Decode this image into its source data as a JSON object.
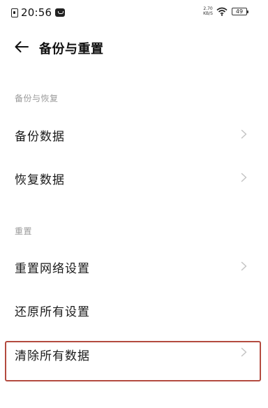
{
  "status_bar": {
    "time": "20:56",
    "net_speed_value": "2.70",
    "net_speed_unit": "KB/S",
    "battery": "49"
  },
  "header": {
    "title": "备份与重置"
  },
  "sections": [
    {
      "title": "备份与恢复",
      "items": [
        {
          "label": "备份数据",
          "chevron": true
        },
        {
          "label": "恢复数据",
          "chevron": true
        }
      ]
    },
    {
      "title": "重置",
      "items": [
        {
          "label": "重置网络设置",
          "chevron": true
        },
        {
          "label": "还原所有设置",
          "chevron": false
        },
        {
          "label": "清除所有数据",
          "chevron": true
        }
      ]
    }
  ],
  "colors": {
    "section_header": "#9a9a9a",
    "chevron": "#c4c4c4",
    "highlight_border": "#b34a3f"
  }
}
